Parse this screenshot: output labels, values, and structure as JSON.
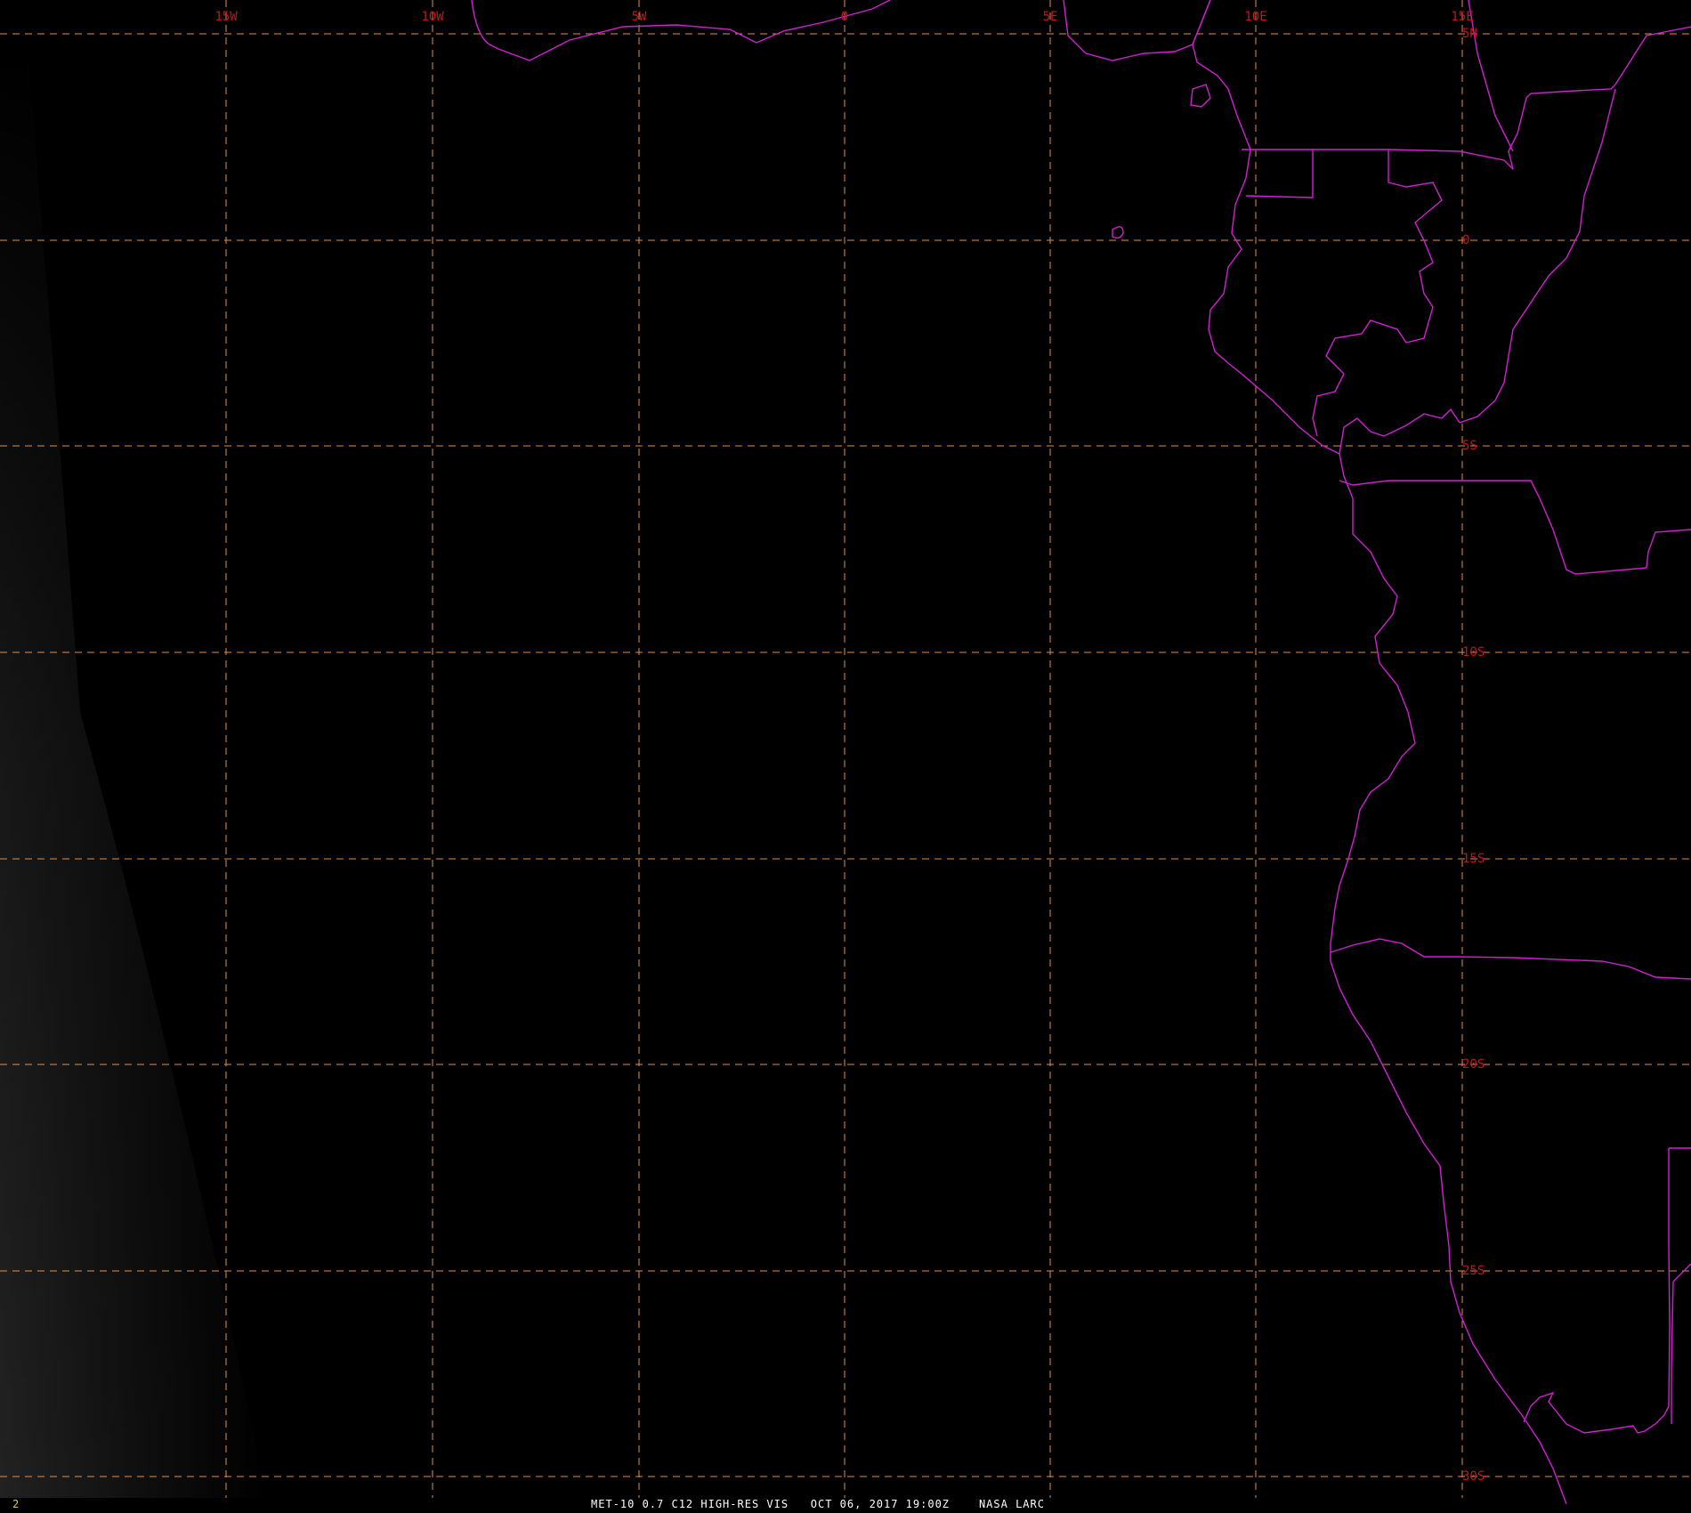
{
  "map": {
    "colors": {
      "background": "#000000",
      "gridline": "#e0904a",
      "grid_label": "#c8141e",
      "coastline": "#d020d0",
      "caption_text": "#ffffff",
      "frame_number": "#d8d800"
    },
    "longitude_labels": [
      "15W",
      "10W",
      "5W",
      "0",
      "5E",
      "10E",
      "15E"
    ],
    "latitude_labels": [
      "5N",
      "0",
      "5S",
      "10S",
      "15S",
      "20S",
      "25S",
      "30S"
    ]
  },
  "caption": {
    "frame_number": "2",
    "satellite_product": "MET-10 0.7 C12 HIGH-RES VIS",
    "timestamp": "OCT 06, 2017 19:00Z",
    "source": "NASA LARC"
  }
}
